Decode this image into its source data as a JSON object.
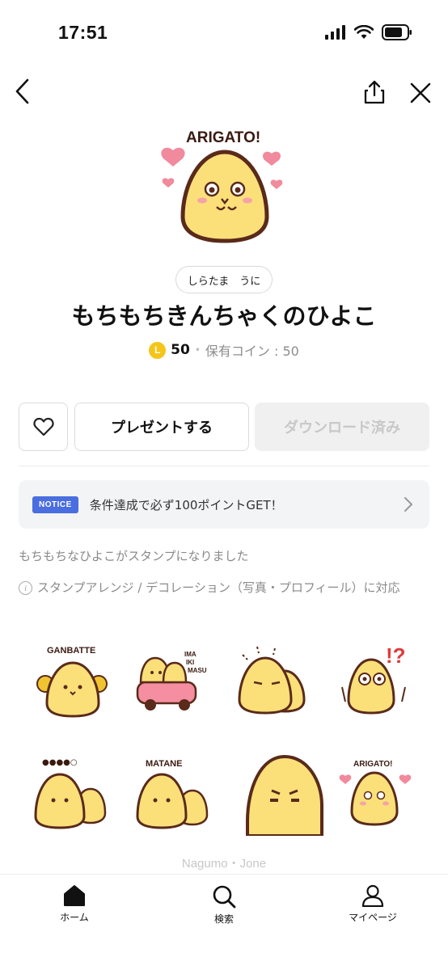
{
  "status": {
    "time": "17:51"
  },
  "product": {
    "author": "しらたま　うに",
    "title": "もちもちきんちゃくのひよこ",
    "coin_symbol": "L",
    "price": "50",
    "separator": "•",
    "owned_label": "保有コイン : 50"
  },
  "buttons": {
    "present": "プレゼントする",
    "download": "ダウンロード済み"
  },
  "notice": {
    "badge": "NOTICE",
    "text": "条件達成で必ず100ポイントGET！"
  },
  "description": "もちもちなひよこがスタンプになりました",
  "info": {
    "icon": "i",
    "text": "スタンプアレンジ / デコレーション（写真・プロフィール）に対応"
  },
  "hero_sticker_text": "ARIGATO!",
  "stickers": [
    {
      "text": "GANBATTE"
    },
    {
      "text": "IMA\nIKI\nMASU"
    },
    {
      "text": ""
    },
    {
      "text": "!?"
    },
    {
      "text": "●●●●○"
    },
    {
      "text": "MATANE"
    },
    {
      "text": ""
    },
    {
      "text": "ARIGATO!"
    }
  ],
  "credit": "Nagumo・Jone",
  "tabs": [
    {
      "label": "ホーム",
      "icon": "home-icon"
    },
    {
      "label": "検索",
      "icon": "search-icon"
    },
    {
      "label": "マイページ",
      "icon": "person-icon"
    }
  ],
  "colors": {
    "chick_body": "#fbe07a",
    "outline": "#5a2a1a",
    "heart": "#f08a9c",
    "notice_badge": "#4a6ee0",
    "coin": "#f5c518"
  }
}
